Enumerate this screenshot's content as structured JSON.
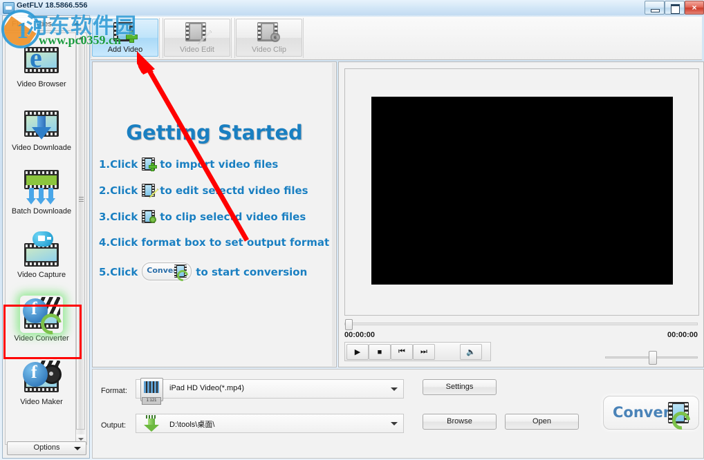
{
  "window": {
    "title": "GetFLV 18.5866.556",
    "minimize_label": "Minimize",
    "maximize_label": "Maximize",
    "close_label": "×"
  },
  "watermark": {
    "logo_char": "1",
    "site_cn": "河东软件园",
    "site_url": "www.pc0359.cn"
  },
  "sidebar": {
    "header_label": "FLV Utilities",
    "items": [
      {
        "label": "Video Browser",
        "icon": "video-browser-icon"
      },
      {
        "label": "Video Downloade",
        "icon": "video-downloader-icon"
      },
      {
        "label": "Batch Downloade",
        "icon": "batch-downloader-icon"
      },
      {
        "label": "Video Capture",
        "icon": "video-capture-icon"
      },
      {
        "label": "Video Converter",
        "icon": "video-converter-icon"
      },
      {
        "label": "Video Maker",
        "icon": "video-maker-icon"
      }
    ],
    "selected": "Video Converter",
    "options_label": "Options"
  },
  "toolbar": {
    "buttons": [
      {
        "label": "Add Video",
        "icon": "add-video-icon",
        "state": "active"
      },
      {
        "label": "Video Edit",
        "icon": "video-edit-icon",
        "state": "disabled"
      },
      {
        "label": "Video Clip",
        "icon": "video-clip-icon",
        "state": "disabled"
      }
    ]
  },
  "getting_started": {
    "title": "Getting Started",
    "steps": [
      {
        "prefix": "1.Click",
        "icon": "add-video-icon",
        "suffix": "to import video files"
      },
      {
        "prefix": "2.Click",
        "icon": "video-edit-icon",
        "suffix": "to edit selectd video files"
      },
      {
        "prefix": "3.Click",
        "icon": "video-clip-icon",
        "suffix": "to clip selectd video files"
      },
      {
        "prefix": "4.Click format box to set output format",
        "icon": "",
        "suffix": ""
      },
      {
        "prefix": "5.Click",
        "icon": "convert-icon",
        "suffix": "to start conversion"
      }
    ],
    "inline_convert_label": "Convert"
  },
  "player": {
    "time_current": "00:00:00",
    "time_total": "00:00:00",
    "controls": [
      {
        "name": "play-button",
        "glyph": "▶"
      },
      {
        "name": "stop-button",
        "glyph": "■"
      },
      {
        "name": "previous-button",
        "glyph": "⏮"
      },
      {
        "name": "next-button",
        "glyph": "⏭"
      },
      {
        "name": "mute-button",
        "glyph": "🔈"
      }
    ]
  },
  "settings": {
    "format_label": "Format:",
    "format_value": "iPad HD Video(*.mp4)",
    "output_label": "Output:",
    "output_value": "D:\\tools\\桌面\\",
    "settings_button": "Settings",
    "browse_button": "Browse",
    "open_button": "Open",
    "convert_button": "Convert"
  },
  "colors": {
    "accent_blue": "#1a7fc1",
    "annotation_red": "#ff0000",
    "active_tab": "#bfe4fa",
    "convert_text": "#4a83b8"
  }
}
